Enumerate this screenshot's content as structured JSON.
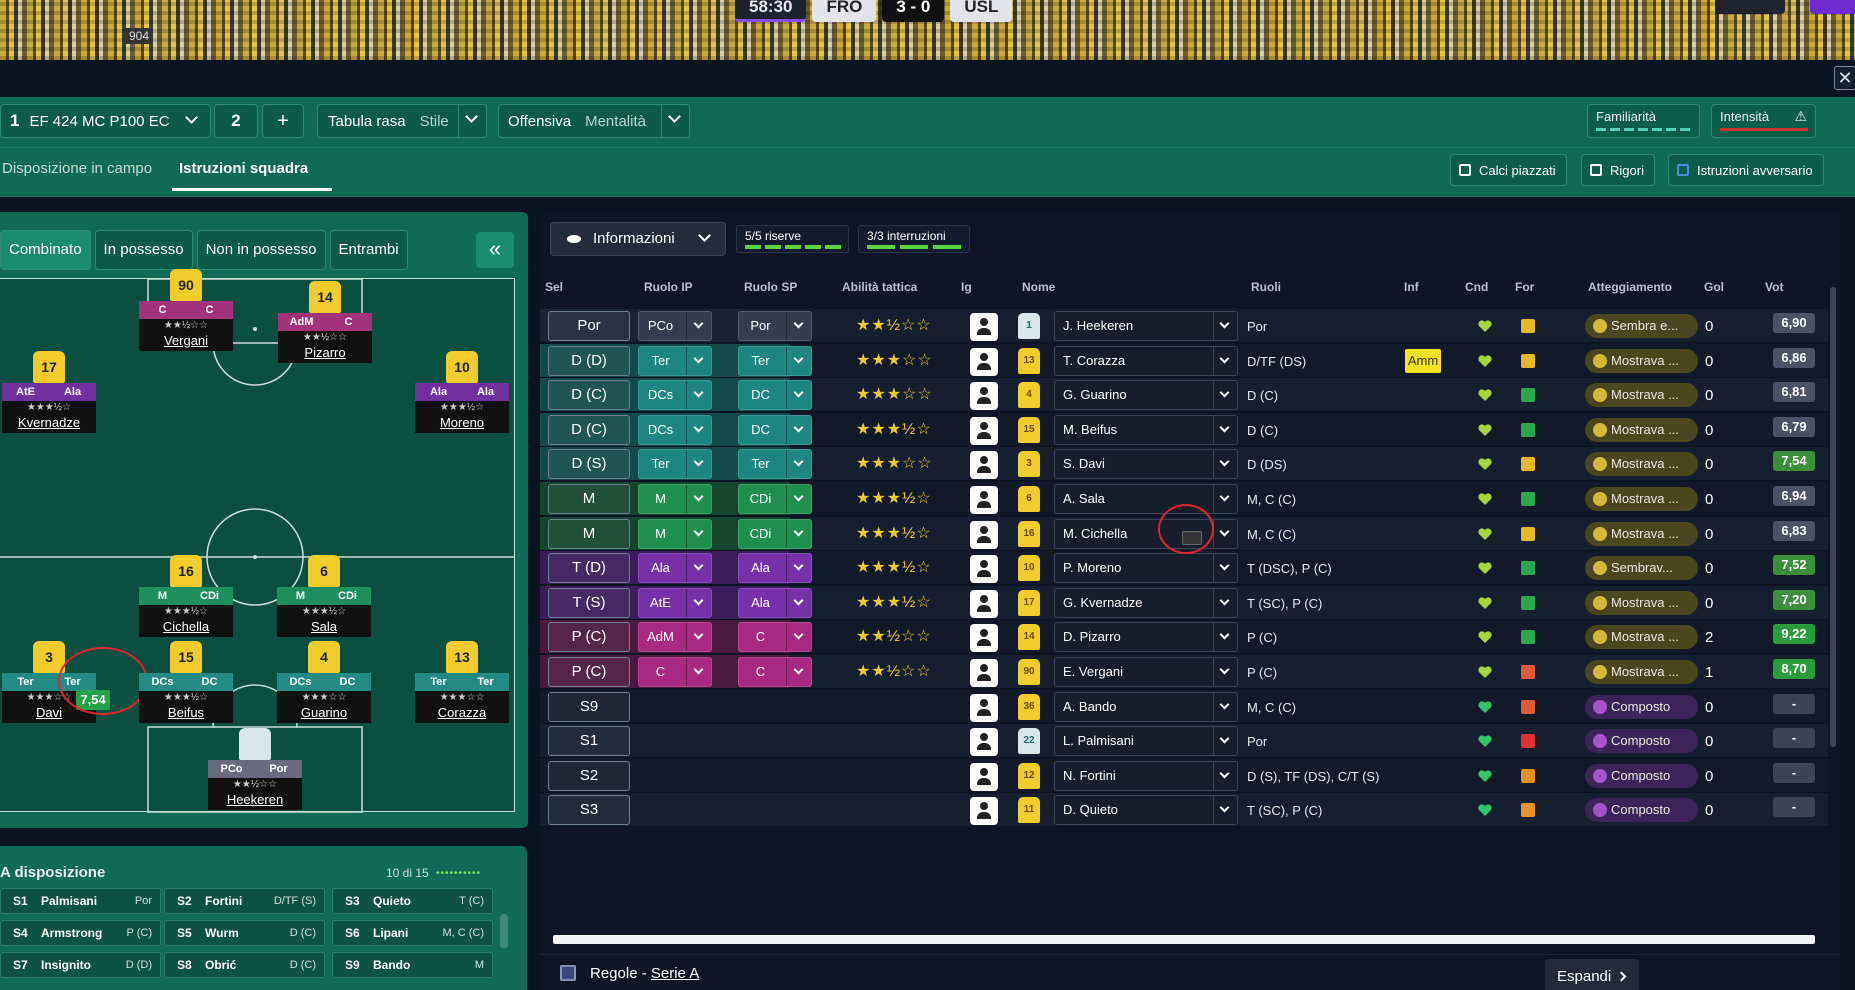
{
  "crowd": {
    "tag": "904",
    "clock": "58:30",
    "home": "FRO",
    "score": "3 - 0",
    "away": "USL"
  },
  "tactics": {
    "slot_number": "1",
    "formation": "EF 424 MC P100 EC",
    "slot2": "2",
    "add": "+",
    "style_name": "Tabula rasa",
    "style_label": "Stile",
    "mentality_name": "Offensiva",
    "mentality_label": "Mentalità",
    "familiarity": "Familiarità",
    "intensity": "Intensità",
    "tabs": [
      "Disposizione in campo",
      "Istruzioni squadra"
    ],
    "right_buttons": [
      "Calci piazzati",
      "Rigori",
      "Istruzioni avversario"
    ]
  },
  "pitch": {
    "tabs": [
      "Combinato",
      "In possesso",
      "Non in possesso",
      "Entrambi"
    ],
    "collapse": "«",
    "players": [
      {
        "num": "90",
        "r1": "C",
        "r2": "C",
        "stars": "★★½☆☆",
        "name": "Vergani"
      },
      {
        "num": "14",
        "r1": "AdM",
        "r2": "C",
        "stars": "★★½☆☆",
        "name": "Pizarro"
      },
      {
        "num": "17",
        "r1": "AtE",
        "r2": "Ala",
        "stars": "★★★½☆",
        "name": "Kvernadze"
      },
      {
        "num": "10",
        "r1": "Ala",
        "r2": "Ala",
        "stars": "★★★½☆",
        "name": "Moreno"
      },
      {
        "num": "16",
        "r1": "M",
        "r2": "CDi",
        "stars": "★★★½☆",
        "name": "Cichella"
      },
      {
        "num": "6",
        "r1": "M",
        "r2": "CDi",
        "stars": "★★★½☆",
        "name": "Sala"
      },
      {
        "num": "3",
        "r1": "Ter",
        "r2": "Ter",
        "stars": "★★★☆☆",
        "name": "Davi"
      },
      {
        "num": "15",
        "r1": "DCs",
        "r2": "DC",
        "stars": "★★★½☆",
        "name": "Beifus"
      },
      {
        "num": "4",
        "r1": "DCs",
        "r2": "DC",
        "stars": "★★★☆☆",
        "name": "Guarino"
      },
      {
        "num": "13",
        "r1": "Ter",
        "r2": "Ter",
        "stars": "★★★☆☆",
        "name": "Corazza"
      },
      {
        "num": "",
        "r1": "PCo",
        "r2": "Por",
        "stars": "★★½☆☆",
        "name": "Heekeren"
      }
    ],
    "davi_rating": "7,54"
  },
  "bench": {
    "title": "A disposizione",
    "count": "10 di 15",
    "dots": "••••••••••",
    "items": [
      {
        "id": "S1",
        "name": "Palmisani",
        "role": "Por"
      },
      {
        "id": "S2",
        "name": "Fortini",
        "role": "D/TF (S)"
      },
      {
        "id": "S3",
        "name": "Quieto",
        "role": "T (C)"
      },
      {
        "id": "S4",
        "name": "Armstrong",
        "role": "P (C)"
      },
      {
        "id": "S5",
        "name": "Wurm",
        "role": "D (C)"
      },
      {
        "id": "S6",
        "name": "Lipani",
        "role": "M, C (C)"
      },
      {
        "id": "S7",
        "name": "Insignito",
        "role": "D (D)"
      },
      {
        "id": "S8",
        "name": "Obrić",
        "role": "D (C)"
      },
      {
        "id": "S9",
        "name": "Bando",
        "role": "M"
      }
    ]
  },
  "table": {
    "info_label": "Informazioni",
    "reserves": "5/5 riserve",
    "interruptions": "3/3 interruzioni",
    "headers": [
      "Sel",
      "Ruolo IP",
      "Ruolo SP",
      "Abilità tattica",
      "Ig",
      "Nome",
      "Ruoli",
      "Inf",
      "Cnd",
      "For",
      "Atteggiamento",
      "Gol",
      "Vot"
    ],
    "rows": [
      {
        "sel": "Por",
        "ip": "PCo",
        "sp": "Por",
        "stars": "★★½☆☆",
        "num": "1",
        "name": "J. Heekeren",
        "roles": "Por",
        "inf": "",
        "form": "yellow",
        "att": "Sembra e...",
        "gol": "0",
        "vot": "6,90"
      },
      {
        "sel": "D (D)",
        "ip": "Ter",
        "sp": "Ter",
        "stars": "★★★☆☆",
        "num": "13",
        "name": "T. Corazza",
        "roles": "D/TF (DS)",
        "inf": "Amm",
        "form": "yellow",
        "att": "Mostrava ...",
        "gol": "0",
        "vot": "6,86"
      },
      {
        "sel": "D (C)",
        "ip": "DCs",
        "sp": "DC",
        "stars": "★★★☆☆",
        "num": "4",
        "name": "G. Guarino",
        "roles": "D (C)",
        "inf": "",
        "form": "green",
        "att": "Mostrava ...",
        "gol": "0",
        "vot": "6,81"
      },
      {
        "sel": "D (C)",
        "ip": "DCs",
        "sp": "DC",
        "stars": "★★★½☆",
        "num": "15",
        "name": "M. Beifus",
        "roles": "D (C)",
        "inf": "",
        "form": "green",
        "att": "Mostrava ...",
        "gol": "0",
        "vot": "6,79"
      },
      {
        "sel": "D (S)",
        "ip": "Ter",
        "sp": "Ter",
        "stars": "★★★☆☆",
        "num": "3",
        "name": "S. Davi",
        "roles": "D (DS)",
        "inf": "",
        "form": "yellow",
        "att": "Mostrava ...",
        "gol": "0",
        "vot": "7,54"
      },
      {
        "sel": "M",
        "ip": "M",
        "sp": "CDi",
        "stars": "★★★½☆",
        "num": "6",
        "name": "A. Sala",
        "roles": "M, C (C)",
        "inf": "",
        "form": "green",
        "att": "Mostrava ...",
        "gol": "0",
        "vot": "6,94"
      },
      {
        "sel": "M",
        "ip": "M",
        "sp": "CDi",
        "stars": "★★★½☆",
        "num": "16",
        "name": "M. Cichella",
        "roles": "M, C (C)",
        "inf": "",
        "form": "yellow",
        "att": "Mostrava ...",
        "gol": "0",
        "vot": "6,83"
      },
      {
        "sel": "T (D)",
        "ip": "Ala",
        "sp": "Ala",
        "stars": "★★★½☆",
        "num": "10",
        "name": "P. Moreno",
        "roles": "T (DSC), P (C)",
        "inf": "",
        "form": "green",
        "att": "Sembrav...",
        "gol": "0",
        "vot": "7,52"
      },
      {
        "sel": "T (S)",
        "ip": "AtE",
        "sp": "Ala",
        "stars": "★★★½☆",
        "num": "17",
        "name": "G. Kvernadze",
        "roles": "T (SC), P (C)",
        "inf": "",
        "form": "green",
        "att": "Mostrava ...",
        "gol": "0",
        "vot": "7,20"
      },
      {
        "sel": "P (C)",
        "ip": "AdM",
        "sp": "C",
        "stars": "★★½☆☆",
        "num": "14",
        "name": "D. Pizarro",
        "roles": "P (C)",
        "inf": "",
        "form": "green",
        "att": "Mostrava ...",
        "gol": "2",
        "vot": "9,22"
      },
      {
        "sel": "P (C)",
        "ip": "C",
        "sp": "C",
        "stars": "★★½☆☆",
        "num": "90",
        "name": "E. Vergani",
        "roles": "P (C)",
        "inf": "",
        "form": "red",
        "att": "Mostrava ...",
        "gol": "1",
        "vot": "8,70"
      },
      {
        "sel": "S9",
        "ip": "",
        "sp": "",
        "stars": "",
        "num": "36",
        "name": "A. Bando",
        "roles": "M, C (C)",
        "inf": "",
        "form": "red",
        "att": "Composto",
        "gol": "0",
        "vot": "-"
      },
      {
        "sel": "S1",
        "ip": "",
        "sp": "",
        "stars": "",
        "num": "22",
        "name": "L. Palmisani",
        "roles": "Por",
        "inf": "",
        "form": "redx",
        "att": "Composto",
        "gol": "0",
        "vot": "-"
      },
      {
        "sel": "S2",
        "ip": "",
        "sp": "",
        "stars": "",
        "num": "12",
        "name": "N. Fortini",
        "roles": "D (S), TF (DS), C/T (S)",
        "inf": "",
        "form": "orange",
        "att": "Composto",
        "gol": "0",
        "vot": "-"
      },
      {
        "sel": "S3",
        "ip": "",
        "sp": "",
        "stars": "",
        "num": "11",
        "name": "D. Quieto",
        "roles": "T (SC), P (C)",
        "inf": "",
        "form": "orange",
        "att": "Composto",
        "gol": "0",
        "vot": "-"
      }
    ],
    "rules_prefix": "Regole - ",
    "rules_link": "Serie A",
    "expand": "Espandi"
  }
}
